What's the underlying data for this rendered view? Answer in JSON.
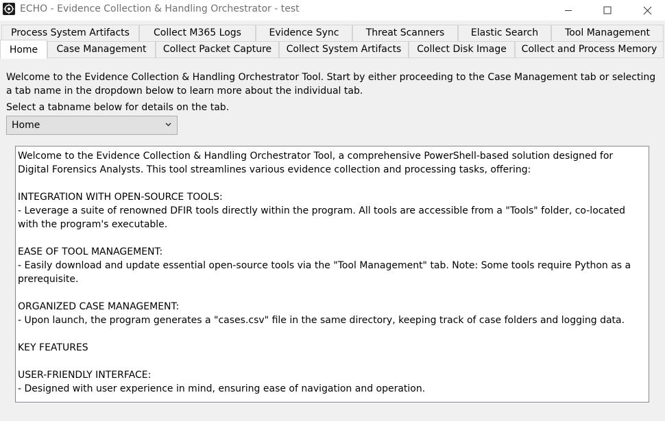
{
  "window": {
    "title": "ECHO - Evidence Collection & Handling Orchestrator - test"
  },
  "tabs_row1": [
    "Process System Artifacts",
    "Collect M365 Logs",
    "Evidence Sync",
    "Threat Scanners",
    "Elastic Search",
    "Tool Management"
  ],
  "tabs_row2": [
    "Home",
    "Case Management",
    "Collect Packet Capture",
    "Collect System Artifacts",
    "Collect Disk Image",
    "Collect and Process Memory"
  ],
  "active_tab": "Home",
  "home": {
    "intro": "Welcome to the Evidence Collection & Handling Orchestrator Tool. Start by either proceeding to the Case Management tab or selecting a tab name in the dropdown below to learn more about the individual tab.",
    "select_label": "Select a tabname below for details on the tab.",
    "dropdown_value": "Home",
    "details": {
      "p1": "Welcome to the Evidence Collection & Handling Orchestrator Tool, a comprehensive PowerShell-based solution designed for Digital Forensics Analysts. This tool streamlines various evidence collection and processing tasks, offering:",
      "h1": "INTEGRATION WITH OPEN-SOURCE TOOLS:",
      "t1": "- Leverage a suite of renowned DFIR tools directly within the program. All tools are accessible from a \"Tools\" folder, co-located with the program's executable.",
      "h2": "EASE OF TOOL MANAGEMENT:",
      "t2": "- Easily download and update essential open-source tools via the \"Tool Management\" tab. Note: Some tools require Python as a prerequisite.",
      "h3": "ORGANIZED CASE MANAGEMENT:",
      "t3": "- Upon launch, the program generates a \"cases.csv\" file in the same directory, keeping track of case folders and logging data.",
      "h4": "KEY FEATURES",
      "h5": "USER-FRIENDLY INTERFACE:",
      "t5": "- Designed with user experience in mind, ensuring ease of navigation and operation."
    }
  },
  "icons": {
    "app": "echo-app-icon",
    "minimize": "minimize-icon",
    "maximize": "maximize-icon",
    "close": "close-icon",
    "dropdown": "chevron-down-icon"
  }
}
